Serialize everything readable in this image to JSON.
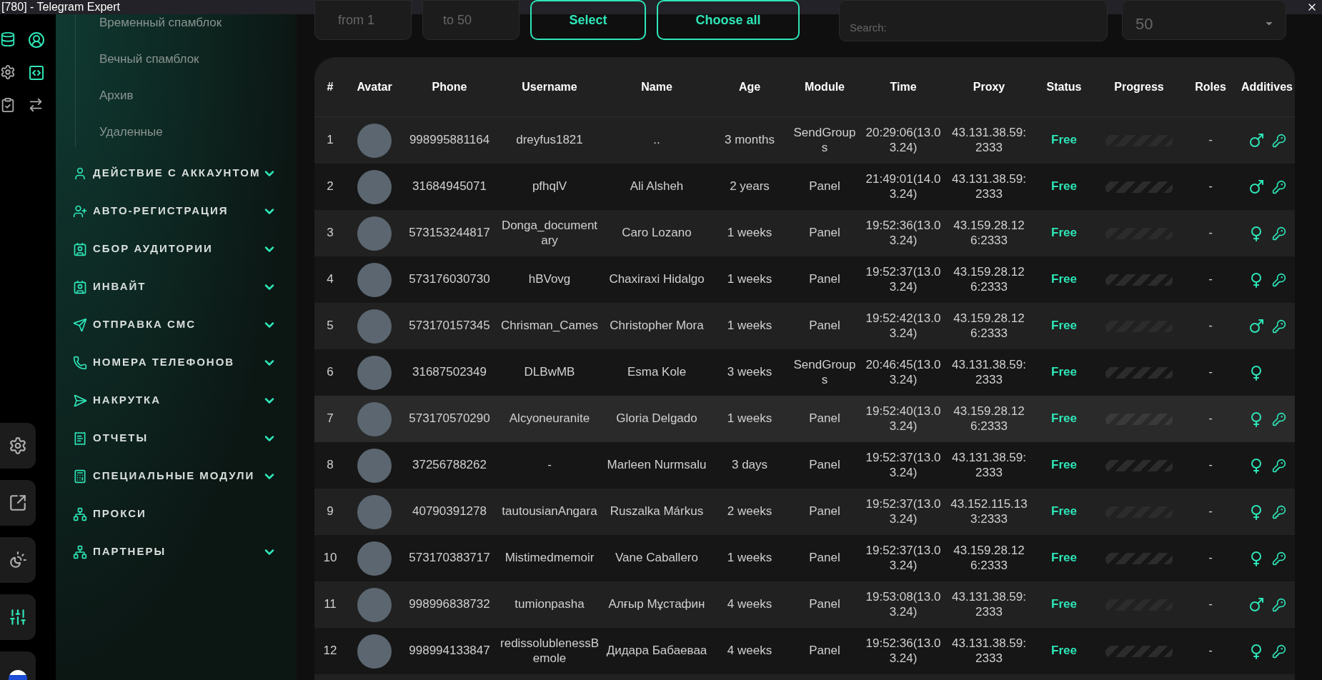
{
  "window": {
    "title": "[780] - Telegram Expert"
  },
  "sidebar": {
    "subitems": [
      "Временный спамблок",
      "Вечный спамблок",
      "Архив",
      "Удаленные"
    ],
    "sections": [
      {
        "label": "ДЕЙСТВИЕ С АККАУНТОМ",
        "expandable": true
      },
      {
        "label": "АВТО-РЕГИСТРАЦИЯ",
        "expandable": true
      },
      {
        "label": "СБОР АУДИТОРИИ",
        "expandable": true
      },
      {
        "label": "ИНВАЙТ",
        "expandable": true
      },
      {
        "label": "ОТПРАВКА СМС",
        "expandable": true
      },
      {
        "label": "НОМЕРА ТЕЛЕФОНОВ",
        "expandable": true
      },
      {
        "label": "НАКРУТКА",
        "expandable": true
      },
      {
        "label": "ОТЧЕТЫ",
        "expandable": true
      },
      {
        "label": "СПЕЦИАЛЬНЫЕ МОДУЛИ",
        "expandable": true
      },
      {
        "label": "ПРОКСИ",
        "expandable": false
      },
      {
        "label": "ПАРТНЕРЫ",
        "expandable": true
      }
    ]
  },
  "rail": {
    "bottom_buttons": [
      {
        "selected": false
      },
      {
        "selected": false
      },
      {
        "selected": false
      },
      {
        "selected": true
      }
    ]
  },
  "toolbar": {
    "from": "from 1",
    "to": "to 50",
    "select_button": "Select",
    "choose_all_button": "Choose all",
    "search": {
      "placeholder": "Search:"
    },
    "page_size": "50"
  },
  "table": {
    "columns": [
      "#",
      "Avatar",
      "Phone",
      "Username",
      "Name",
      "Age",
      "Module",
      "Time",
      "Proxy",
      "Status",
      "Progress",
      "Roles",
      "Additives"
    ],
    "rows": [
      {
        "num": "1",
        "phone": "998995881164",
        "username": "dreyfus1821",
        "name": "..",
        "age": "3 months",
        "module": "SendGroups",
        "time": "20:29:06(13.03.24)",
        "proxy": "43.131.38.59:2333",
        "status": "Free",
        "roles": "-",
        "male": true,
        "key": true,
        "hovered": false
      },
      {
        "num": "2",
        "phone": "31684945071",
        "username": "pfhqlV",
        "name": "Ali Alsheh",
        "age": "2 years",
        "module": "Panel",
        "time": "21:49:01(14.03.24)",
        "proxy": "43.131.38.59:2333",
        "status": "Free",
        "roles": "-",
        "male": true,
        "key": true,
        "hovered": false
      },
      {
        "num": "3",
        "phone": "573153244817",
        "username": "Donga_documentary",
        "name": "Caro Lozano",
        "age": "1 weeks",
        "module": "Panel",
        "time": "19:52:36(13.03.24)",
        "proxy": "43.159.28.126:2333",
        "status": "Free",
        "roles": "-",
        "male": false,
        "key": true,
        "hovered": false
      },
      {
        "num": "4",
        "phone": "573176030730",
        "username": "hBVovg",
        "name": "Chaxiraxi Hidalgo",
        "age": "1 weeks",
        "module": "Panel",
        "time": "19:52:37(13.03.24)",
        "proxy": "43.159.28.126:2333",
        "status": "Free",
        "roles": "-",
        "male": false,
        "key": true,
        "hovered": false
      },
      {
        "num": "5",
        "phone": "573170157345",
        "username": "Chrisman_Cames",
        "name": "Christopher Mora",
        "age": "1 weeks",
        "module": "Panel",
        "time": "19:52:42(13.03.24)",
        "proxy": "43.159.28.126:2333",
        "status": "Free",
        "roles": "-",
        "male": true,
        "key": true,
        "hovered": false
      },
      {
        "num": "6",
        "phone": "31687502349",
        "username": "DLBwMB",
        "name": "Esma Kole",
        "age": "3 weeks",
        "module": "SendGroups",
        "time": "20:46:45(13.03.24)",
        "proxy": "43.131.38.59:2333",
        "status": "Free",
        "roles": "-",
        "male": false,
        "key": false,
        "hovered": false
      },
      {
        "num": "7",
        "phone": "573170570290",
        "username": "Alcyoneuranite",
        "name": "Gloria Delgado",
        "age": "1 weeks",
        "module": "Panel",
        "time": "19:52:40(13.03.24)",
        "proxy": "43.159.28.126:2333",
        "status": "Free",
        "roles": "-",
        "male": false,
        "key": true,
        "hovered": true
      },
      {
        "num": "8",
        "phone": "37256788262",
        "username": "-",
        "name": "Marleen Nurmsalu",
        "age": "3 days",
        "module": "Panel",
        "time": "19:52:37(13.03.24)",
        "proxy": "43.131.38.59:2333",
        "status": "Free",
        "roles": "-",
        "male": false,
        "key": true,
        "hovered": false
      },
      {
        "num": "9",
        "phone": "40790391278",
        "username": "tautousianAngara",
        "name": "Ruszalka Márkus",
        "age": "2 weeks",
        "module": "Panel",
        "time": "19:52:37(13.03.24)",
        "proxy": "43.152.115.133:2333",
        "status": "Free",
        "roles": "-",
        "male": false,
        "key": true,
        "hovered": false
      },
      {
        "num": "10",
        "phone": "573170383717",
        "username": "Mistimedmemoir",
        "name": "Vane Caballero",
        "age": "1 weeks",
        "module": "Panel",
        "time": "19:52:37(13.03.24)",
        "proxy": "43.159.28.126:2333",
        "status": "Free",
        "roles": "-",
        "male": false,
        "key": true,
        "hovered": false
      },
      {
        "num": "11",
        "phone": "998996838732",
        "username": "tumionpasha",
        "name": "Алғыр Мұстафин",
        "age": "4 weeks",
        "module": "Panel",
        "time": "19:53:08(13.03.24)",
        "proxy": "43.131.38.59:2333",
        "status": "Free",
        "roles": "-",
        "male": true,
        "key": true,
        "hovered": false
      },
      {
        "num": "12",
        "phone": "998994133847",
        "username": "redissolublenessBemole",
        "name": "Дидара Бабаеваа",
        "age": "4 weeks",
        "module": "Panel",
        "time": "19:52:36(13.03.24)",
        "proxy": "43.131.38.59:2333",
        "status": "Free",
        "roles": "-",
        "male": false,
        "key": true,
        "hovered": false
      }
    ]
  }
}
